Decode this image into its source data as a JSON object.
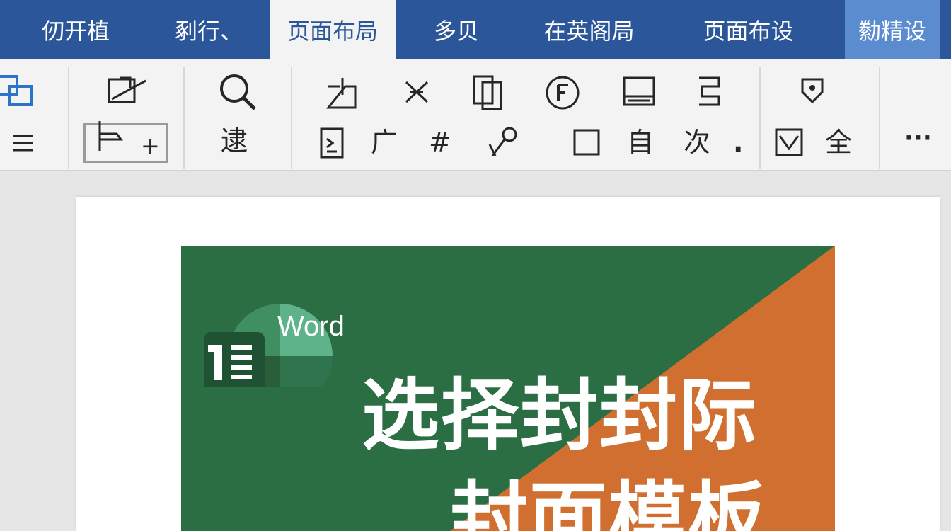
{
  "ribbon_tabs": [
    {
      "label": "仞开植"
    },
    {
      "label": "剢行、"
    },
    {
      "label": "页面布局"
    },
    {
      "label": "多贝"
    },
    {
      "label": "在英阁局"
    },
    {
      "label": "页面布设"
    },
    {
      "label": "勬精设"
    }
  ],
  "active_tab": "页面布局",
  "ribbon": {
    "row1_glyphs": [],
    "search_label": "逮",
    "row2_glyphs": [
      "广",
      "#",
      "自",
      "次",
      ".",
      "全"
    ],
    "plus": "+",
    "more": "···"
  },
  "colors": {
    "tab_bar": "#2b579a",
    "cover_green": "#2b6e44",
    "cover_orange": "#d06f2f"
  },
  "document": {
    "cover": {
      "brand": "Word",
      "title_line1": "选择封封际",
      "title_line2": "封面模板"
    }
  }
}
